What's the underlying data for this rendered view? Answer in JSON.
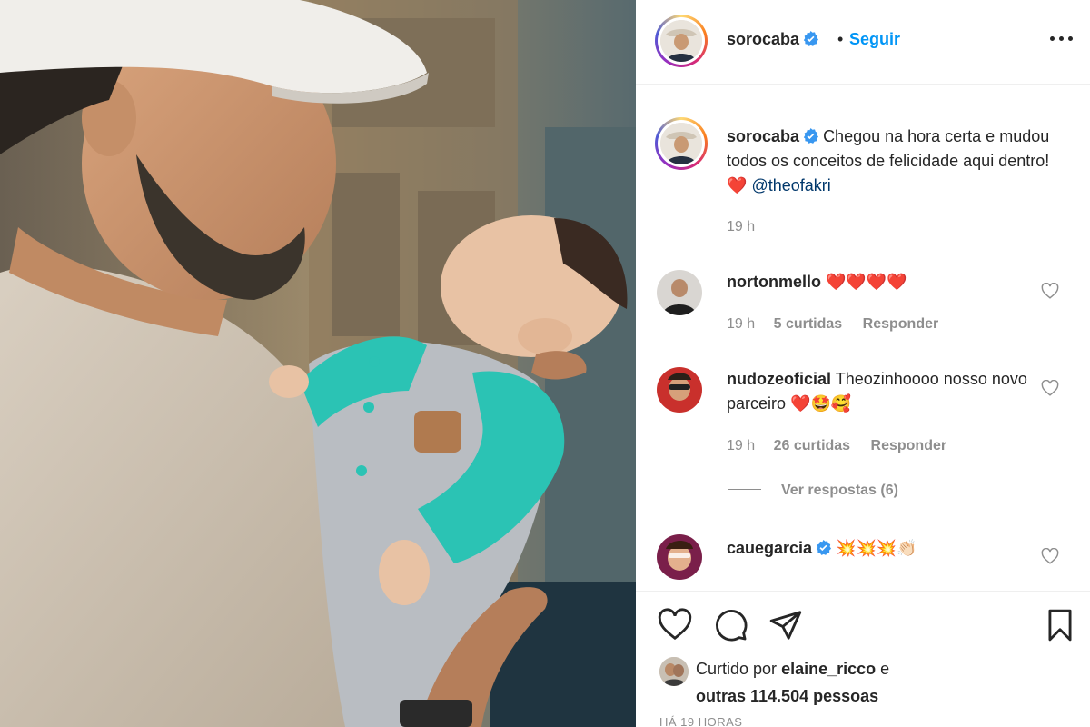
{
  "post": {
    "username": "sorocaba",
    "follow_label": "Seguir",
    "separator": "•"
  },
  "caption": {
    "username": "sorocaba",
    "text": "Chegou na hora certa e mudou todos os conceitos de felicidade aqui dentro!",
    "emoji": "❤️",
    "mention": "@theofakri",
    "time": "19 h"
  },
  "comments": [
    {
      "username": "nortonmello",
      "text": "❤️❤️❤️❤️",
      "time": "19 h",
      "likes": "5 curtidas",
      "reply": "Responder"
    },
    {
      "username": "nudozeoficial",
      "text": "Theozinhoooo nosso novo parceiro",
      "emoji": "❤️🤩🥰",
      "time": "19 h",
      "likes": "26 curtidas",
      "reply": "Responder"
    },
    {
      "username": "cauegarcia",
      "text": "💥💥💥👏🏻"
    }
  ],
  "view_replies": "Ver respostas (6)",
  "likes": {
    "prefix": "Curtido por",
    "user": "elaine_ricco",
    "conj": "e",
    "others": "outras 114.504 pessoas"
  },
  "posted_ago": "HÁ 19 HORAS",
  "colors": {
    "link_blue": "#0095f6",
    "mention_blue": "#00376b",
    "verified_blue": "#3897f0",
    "heart_red": "#ed4956",
    "muted": "#8e8e8e"
  },
  "icons": [
    "verified-icon",
    "more-options-icon",
    "heart-icon",
    "comment-icon",
    "share-icon",
    "bookmark-icon"
  ]
}
